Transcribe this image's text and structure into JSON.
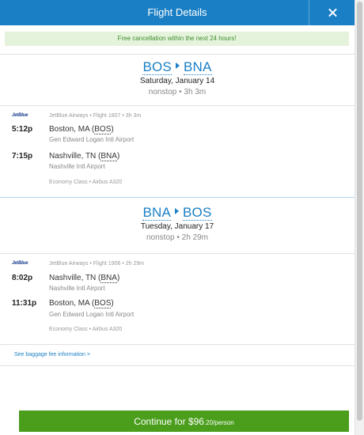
{
  "header": {
    "title": "Flight Details"
  },
  "notice": "Free cancellation within the next 24 hours!",
  "outbound": {
    "from": "BOS",
    "to": "BNA",
    "date": "Saturday, January 14",
    "meta": "nonstop • 3h 3m",
    "airline_logo": "JetBlue",
    "flight_info": "JetBlue Airways • Flight 1807 • 3h 3m",
    "depart": {
      "time": "5:12p",
      "city": "Boston, MA",
      "iata": "BOS",
      "airport": "Gen Edward Logan Intl Airport"
    },
    "arrive": {
      "time": "7:15p",
      "city": "Nashville, TN",
      "iata": "BNA",
      "airport": "Nashville Intl Airport"
    },
    "class_info": "Economy Class • Airbus A320"
  },
  "return": {
    "from": "BNA",
    "to": "BOS",
    "date": "Tuesday, January 17",
    "meta": "nonstop • 2h 29m",
    "airline_logo": "JetBlue",
    "flight_info": "JetBlue Airways • Flight 1906 • 2h 29m",
    "depart": {
      "time": "8:02p",
      "city": "Nashville, TN",
      "iata": "BNA",
      "airport": "Nashville Intl Airport"
    },
    "arrive": {
      "time": "11:31p",
      "city": "Boston, MA",
      "iata": "BOS",
      "airport": "Gen Edward Logan Intl Airport"
    },
    "class_info": "Economy Class • Airbus A320"
  },
  "baggage_link": "See baggage fee information >",
  "continue": {
    "main": "Continue for $96",
    "sub": ".20/person"
  },
  "colors": {
    "accent": "#1a7fc4",
    "notice_bg": "#e5f3dc",
    "notice_text": "#3f8f2e",
    "button": "#4a9e1c"
  }
}
